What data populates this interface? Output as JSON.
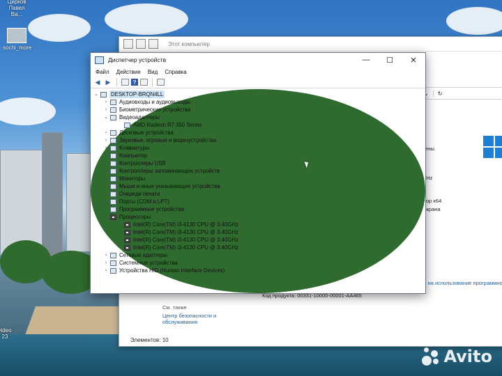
{
  "desktop": {
    "icons": [
      {
        "label": "Цирков\nПавел Ва..."
      },
      {
        "label": "sochi_more"
      },
      {
        "label": "video\n23"
      }
    ]
  },
  "background_window": {
    "title": "Этот компьютер",
    "refresh_icon": "refresh-icon",
    "text_done": "ены.",
    "cpu_freq": "30 GHz",
    "cpu_arch": "ессор x64",
    "screen": "го экрана",
    "license_link": "ения на использование программного о",
    "product_key": "Код продукта: 00331-10000-00001-AA465",
    "see_also": "См. также",
    "security_center": "Центр безопасности и обслуживания",
    "status": "Элементов: 10"
  },
  "device_manager": {
    "title": "Диспетчер устройств",
    "controls": {
      "minimize": "—",
      "maximize": "☐",
      "close": "✕"
    },
    "menu": [
      "Файл",
      "Действие",
      "Вид",
      "Справка"
    ],
    "toolbar_icons": [
      "back-arrow-icon",
      "forward-arrow-icon",
      "properties-icon",
      "help-icon",
      "update-icon",
      "monitor-icon"
    ],
    "tree": [
      {
        "level": 0,
        "toggle": "⌄",
        "label": "DESKTOP-BRQN4LL",
        "icon": "computer-icon"
      },
      {
        "level": 1,
        "toggle": "›",
        "label": "Аудиовходы и аудиовыходы",
        "icon": "audio-icon"
      },
      {
        "level": 1,
        "toggle": "›",
        "label": "Биометрические устройства",
        "icon": "biometric-icon"
      },
      {
        "level": 1,
        "toggle": "⌄",
        "label": "Видеоадаптеры",
        "icon": "display-adapter-icon"
      },
      {
        "level": 2,
        "toggle": "",
        "label": "AMD Radeon R7 350 Series",
        "icon": "display-adapter-icon"
      },
      {
        "level": 1,
        "toggle": "›",
        "label": "Дисковые устройства",
        "icon": "disk-icon"
      },
      {
        "level": 1,
        "toggle": "›",
        "label": "Звуковые, игровые и видеоустройства",
        "icon": "sound-icon"
      },
      {
        "level": 1,
        "toggle": "›",
        "label": "Клавиатуры",
        "icon": "keyboard-icon"
      },
      {
        "level": 1,
        "toggle": "›",
        "label": "Компьютер",
        "icon": "computer-icon"
      },
      {
        "level": 1,
        "toggle": "›",
        "label": "Контроллеры USB",
        "icon": "usb-icon"
      },
      {
        "level": 1,
        "toggle": "›",
        "label": "Контроллеры запоминающих устройств",
        "icon": "storage-icon"
      },
      {
        "level": 1,
        "toggle": "›",
        "label": "Мониторы",
        "icon": "monitor-icon"
      },
      {
        "level": 1,
        "toggle": "›",
        "label": "Мыши и иные указывающие устройства",
        "icon": "mouse-icon"
      },
      {
        "level": 1,
        "toggle": "›",
        "label": "Очереди печати",
        "icon": "printer-icon"
      },
      {
        "level": 1,
        "toggle": "›",
        "label": "Порты (COM и LPT)",
        "icon": "port-icon"
      },
      {
        "level": 1,
        "toggle": "›",
        "label": "Программные устройства",
        "icon": "software-device-icon"
      },
      {
        "level": 1,
        "toggle": "⌄",
        "label": "Процессоры",
        "icon": "cpu-icon"
      },
      {
        "level": 2,
        "toggle": "",
        "label": "Intel(R) Core(TM) i3-4130 CPU @ 3.40GHz",
        "icon": "cpu-icon"
      },
      {
        "level": 2,
        "toggle": "",
        "label": "Intel(R) Core(TM) i3-4130 CPU @ 3.40GHz",
        "icon": "cpu-icon"
      },
      {
        "level": 2,
        "toggle": "",
        "label": "Intel(R) Core(TM) i3-4130 CPU @ 3.40GHz",
        "icon": "cpu-icon"
      },
      {
        "level": 2,
        "toggle": "",
        "label": "Intel(R) Core(TM) i3-4130 CPU @ 3.40GHz",
        "icon": "cpu-icon"
      },
      {
        "level": 1,
        "toggle": "›",
        "label": "Сетевые адаптеры",
        "icon": "network-icon"
      },
      {
        "level": 1,
        "toggle": "›",
        "label": "Системные устройства",
        "icon": "system-icon"
      },
      {
        "level": 1,
        "toggle": "›",
        "label": "Устройства HID (Human Interface Devices)",
        "icon": "hid-icon"
      }
    ]
  },
  "watermark": {
    "text": "Avito"
  }
}
